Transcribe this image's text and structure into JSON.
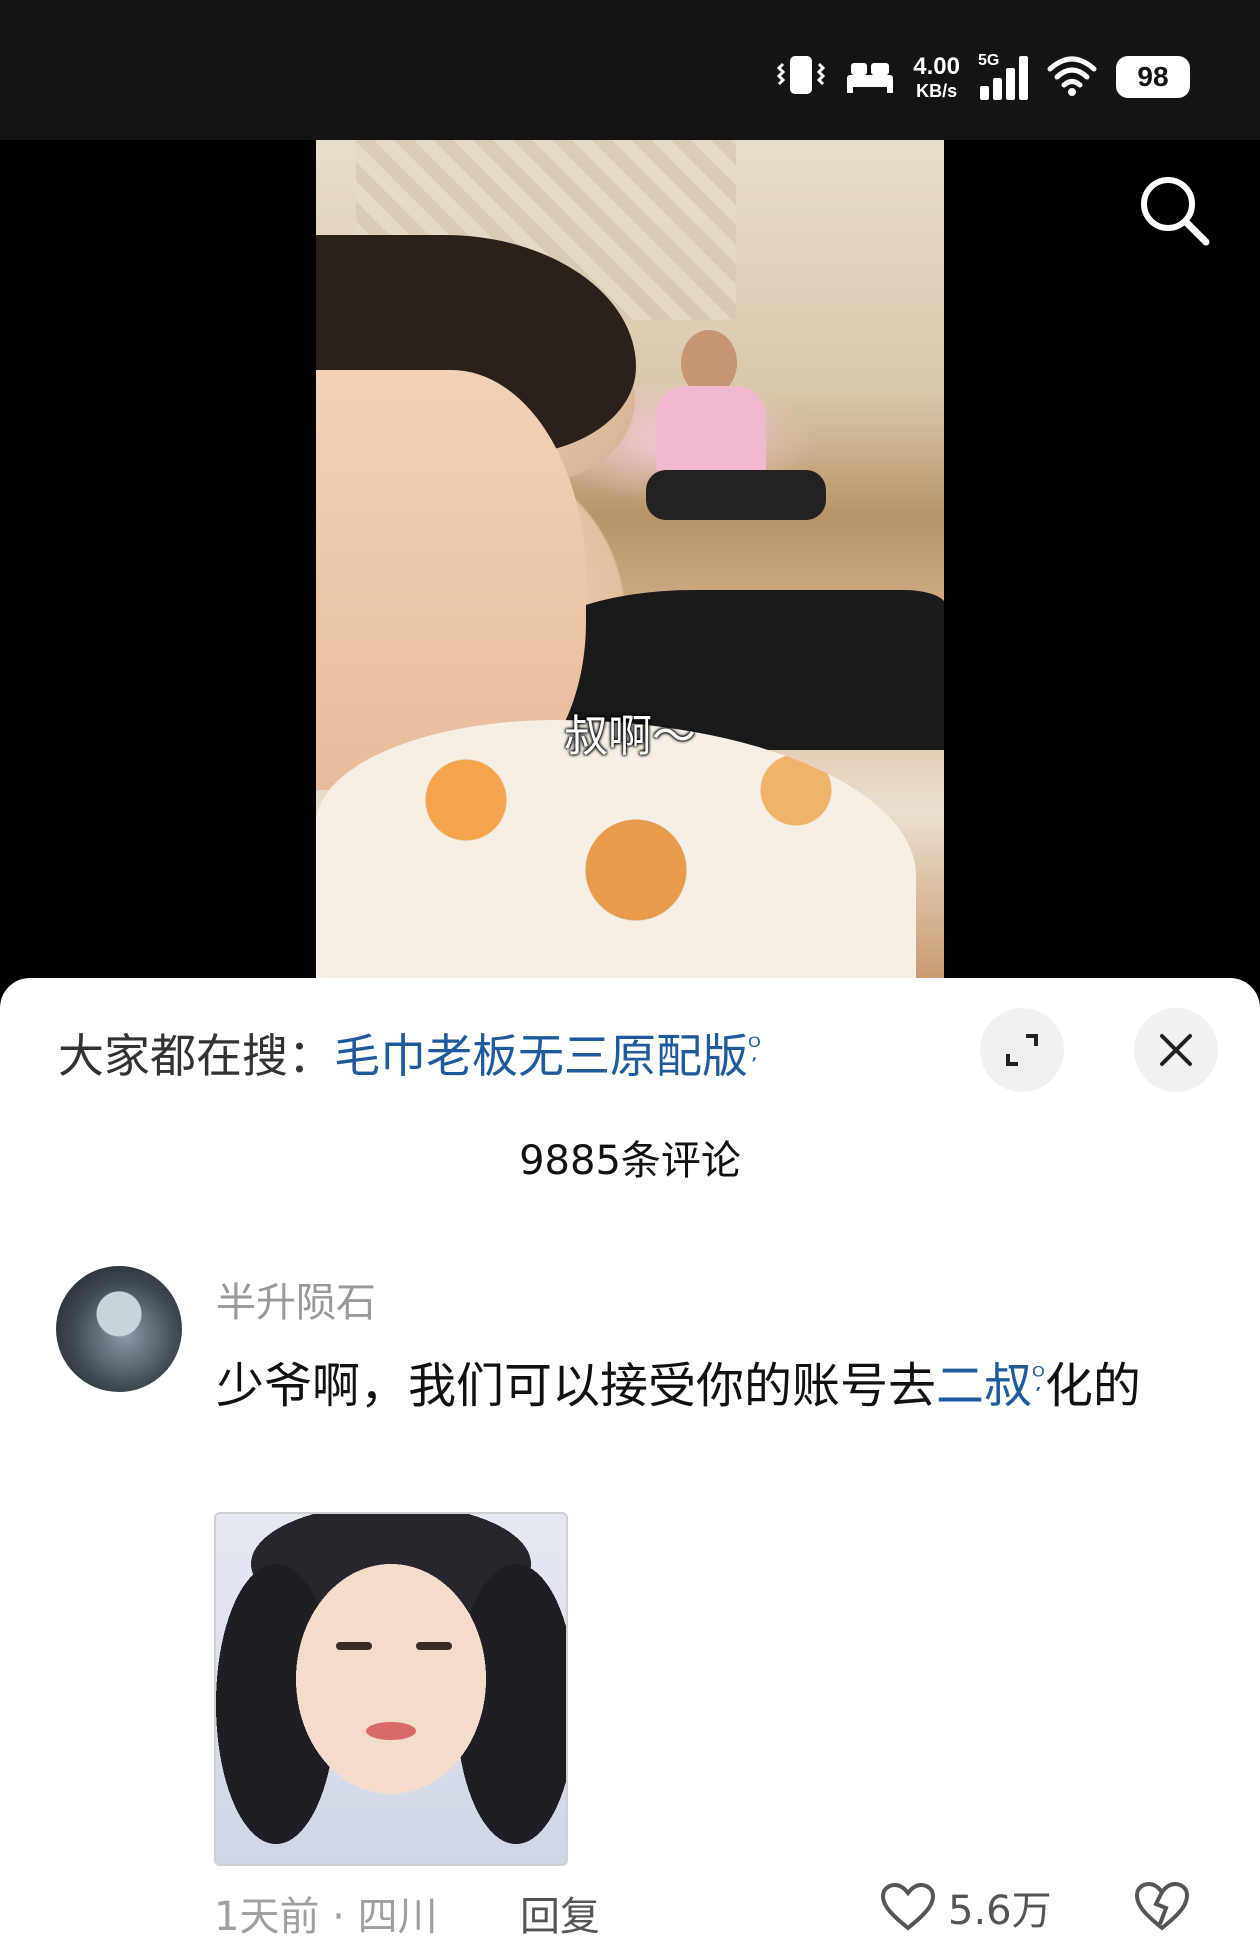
{
  "status_bar": {
    "net_speed_value": "4.00",
    "net_speed_unit": "KB/s",
    "network_type": "5G",
    "battery": "98"
  },
  "video": {
    "subtitle": "叔啊～"
  },
  "comments_sheet": {
    "trending_prefix": "大家都在搜：",
    "trending_keyword": "毛巾老板无三原配版",
    "comment_count": "9885条评论"
  },
  "comment": {
    "username": "半升陨石",
    "text_before": "少爷啊，我们可以接受你的账号去",
    "text_keyword": "二叔",
    "text_after": "化的",
    "time_location": "1天前 · 四川",
    "reply_label": "回复",
    "likes": "5.6万"
  },
  "colors": {
    "link": "#1f5a9c",
    "background_dark": "#000000",
    "sheet_bg": "#ffffff"
  },
  "icons": [
    "vibrate-icon",
    "bed-icon",
    "signal-icon",
    "wifi-icon",
    "battery-icon",
    "search-icon",
    "expand-icon",
    "close-icon",
    "heart-icon",
    "broken-heart-icon"
  ]
}
